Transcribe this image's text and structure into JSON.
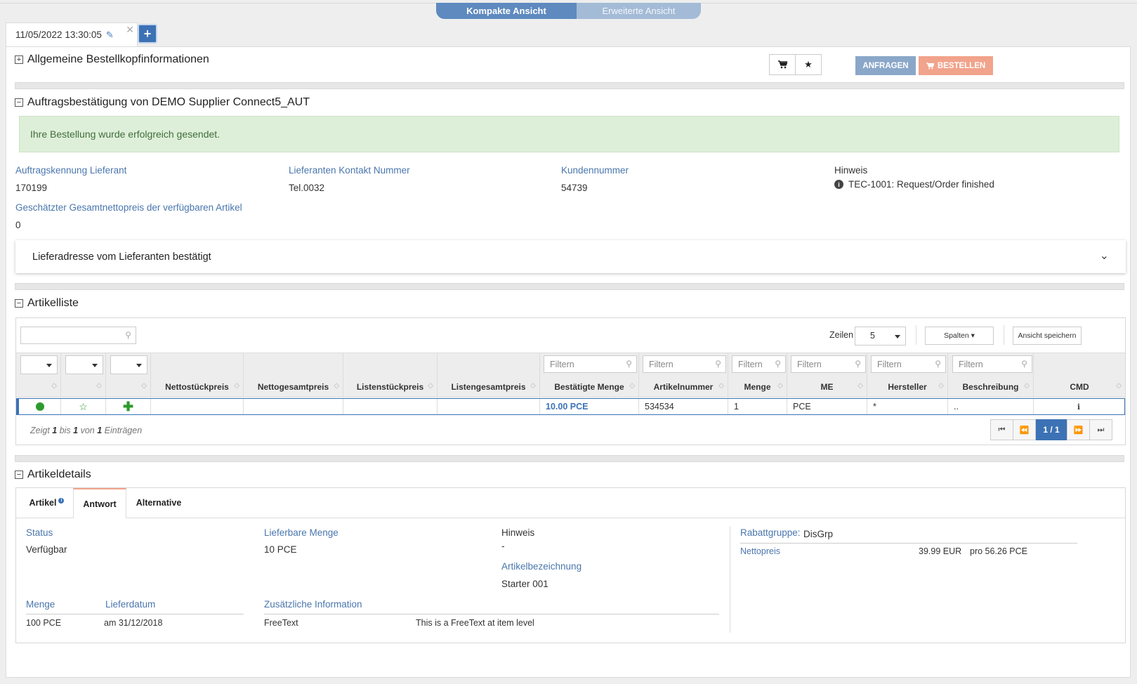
{
  "view_toggle": {
    "compact": "Kompakte Ansicht",
    "extended": "Erweiterte Ansicht"
  },
  "tab": {
    "label": "11/05/2022 13:30:05",
    "close": "✕",
    "add": "+"
  },
  "header_section": {
    "title": "Allgemeine Bestellkopfinformationen",
    "btn_request": "ANFRAGEN",
    "btn_order": "BESTELLEN"
  },
  "confirmation": {
    "title": "Auftragsbestätigung von DEMO Supplier Connect5_AUT",
    "alert": "Ihre Bestellung wurde erfolgreich gesendet.",
    "fields": [
      {
        "label": "Auftragskennung Lieferant",
        "value": "170199"
      },
      {
        "label": "Lieferanten Kontakt Nummer",
        "value": "Tel.0032"
      },
      {
        "label": "Kundennummer",
        "value": "54739"
      },
      {
        "label": "Hinweis",
        "value": "TEC-1001: Request/Order finished"
      },
      {
        "label": "Geschätzter Gesamtnettopreis der verfügbaren Artikel",
        "value": "0"
      }
    ],
    "address_panel": "Lieferadresse vom Lieferanten bestätigt"
  },
  "article_list": {
    "title": "Artikelliste",
    "rows_label": "Zeilen",
    "rows_value": "5",
    "columns_btn": "Spalten",
    "save_view_btn": "Ansicht speichern",
    "filter_placeholder": "Filtern",
    "columns": [
      "Nettostückpreis",
      "Nettogesamtpreis",
      "Listenstückpreis",
      "Listengesamtpreis",
      "Bestätigte Menge",
      "Artikelnummer",
      "Menge",
      "ME",
      "Hersteller",
      "Beschreibung",
      "CMD"
    ],
    "row": {
      "confirmed_qty": "10.00 PCE",
      "article_no": "534534",
      "qty": "1",
      "unit": "PCE",
      "manufacturer": "*",
      "description": "..",
      "cmd": "ℹ"
    },
    "info": {
      "p1": "Zeigt ",
      "n1": "1",
      "p2": " bis ",
      "n2": "1",
      "p3": " von ",
      "n3": "1",
      "p4": " Einträgen"
    },
    "page": "1 / 1"
  },
  "article_details": {
    "title": "Artikeldetails",
    "tabs": [
      "Artikel",
      "Antwort",
      "Alternative"
    ],
    "status_label": "Status",
    "status_value": "Verfügbar",
    "deliverable_label": "Lieferbare Menge",
    "deliverable_value": "10 PCE",
    "hint_label": "Hinweis",
    "hint_value": "-",
    "designation_label": "Artikelbezeichnung",
    "designation_value": "Starter 001",
    "qty_label": "Menge",
    "qty_value": "100 PCE",
    "date_label": "Lieferdatum",
    "date_value": "am 31/12/2018",
    "addinfo_label": "Zusätzliche Information",
    "addinfo_key": "FreeText",
    "addinfo_value": "This is a FreeText at item level",
    "discount_label": "Rabattgruppe:",
    "discount_value": "DisGrp",
    "net_label": "Nettopreis",
    "net_value": "39.99 EUR",
    "net_per": "pro 56.26 PCE"
  },
  "colors": {
    "accent": "#3c72b5",
    "label": "#4a76ad",
    "success_bg": "#deefd9",
    "order_btn": "#f1a38b"
  }
}
